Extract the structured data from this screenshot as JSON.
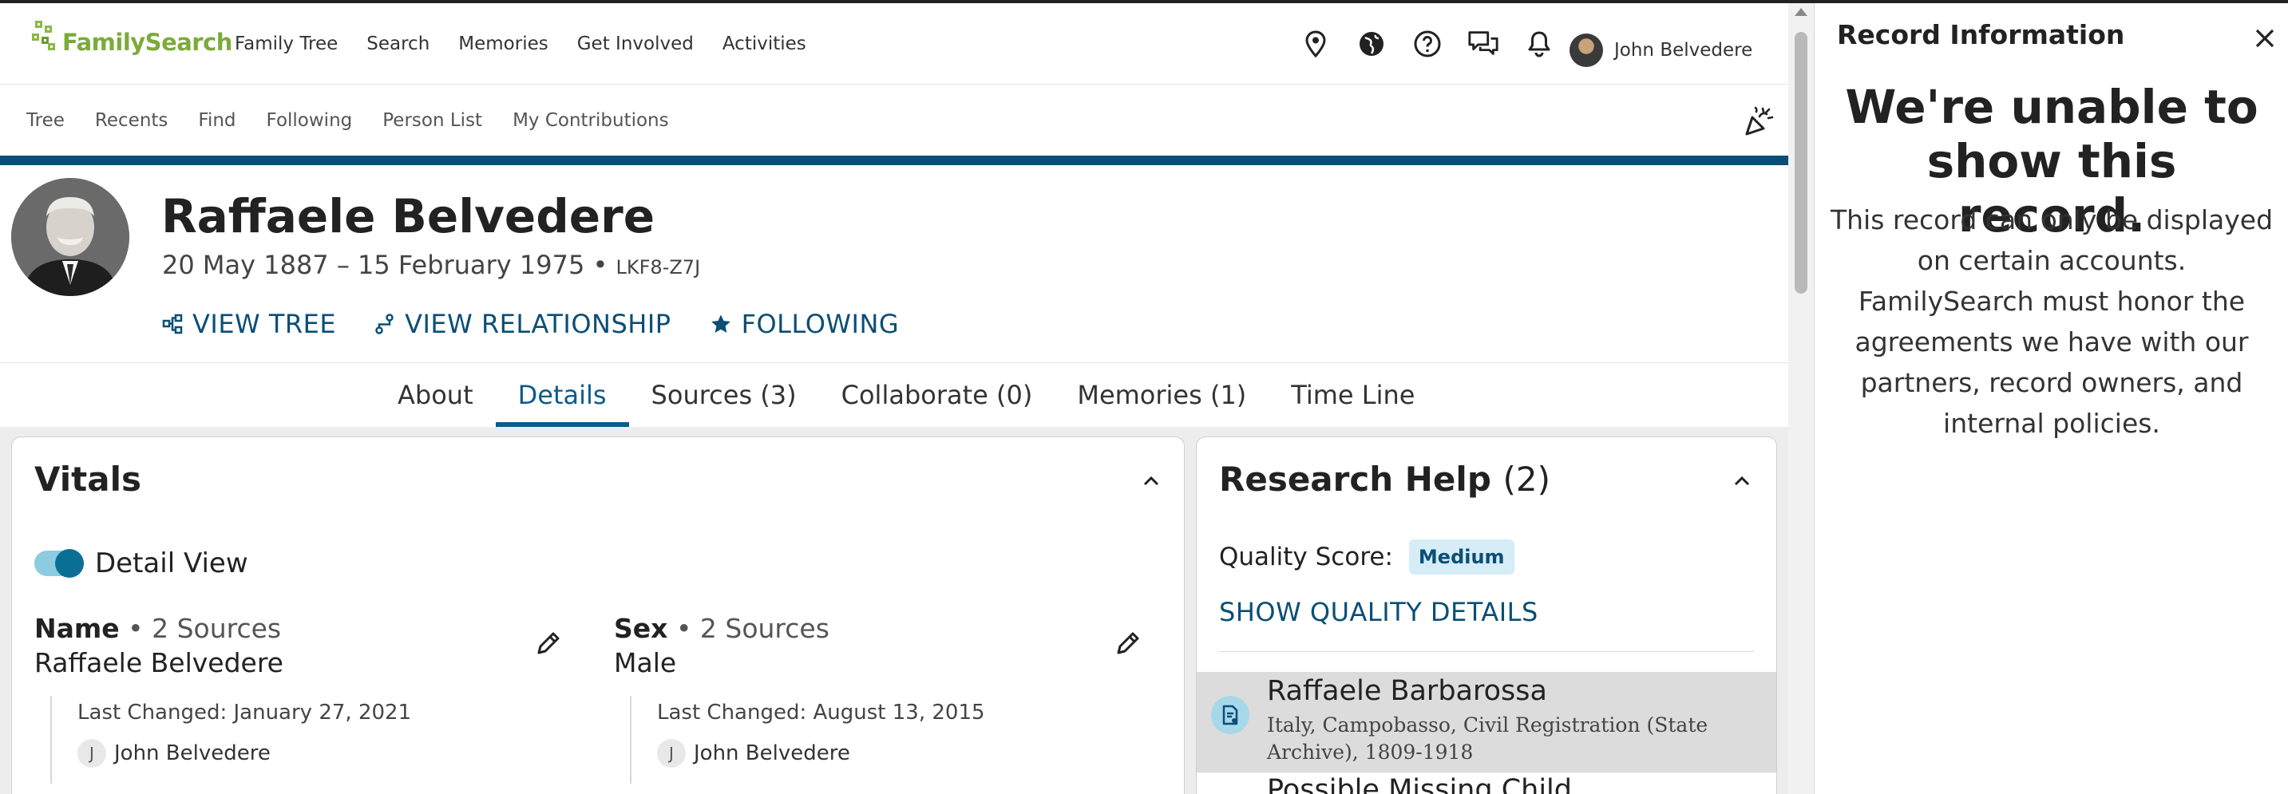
{
  "header": {
    "logo_text": "FamilySearch",
    "nav": [
      "Family Tree",
      "Search",
      "Memories",
      "Get Involved",
      "Activities"
    ],
    "icons": [
      "location-pin-icon",
      "globe-icon",
      "help-icon",
      "chat-icon",
      "bell-icon"
    ],
    "user_name": "John Belvedere"
  },
  "subnav": [
    "Tree",
    "Recents",
    "Find",
    "Following",
    "Person List",
    "My Contributions"
  ],
  "person": {
    "name": "Raffaele Belvedere",
    "dates": "20 May 1887 – 15 February 1975",
    "separator": " • ",
    "pid": "LKF8-Z7J",
    "actions": {
      "view_tree": "VIEW TREE",
      "view_relationship": "VIEW RELATIONSHIP",
      "following": "FOLLOWING"
    }
  },
  "tabs": [
    {
      "label": "About"
    },
    {
      "label": "Details"
    },
    {
      "label": "Sources (3)"
    },
    {
      "label": "Collaborate (0)"
    },
    {
      "label": "Memories (1)"
    },
    {
      "label": "Time Line"
    }
  ],
  "vitals": {
    "title": "Vitals",
    "toggle_label": "Detail View",
    "name_field": {
      "label": "Name",
      "sources": "• 2 Sources",
      "value": "Raffaele Belvedere",
      "last_changed": "Last Changed: January 27, 2021",
      "by_initial": "J",
      "by": "John Belvedere"
    },
    "sex_field": {
      "label": "Sex",
      "sources": "• 2 Sources",
      "value": "Male",
      "last_changed": "Last Changed: August 13, 2015",
      "by_initial": "J",
      "by": "John Belvedere"
    }
  },
  "research": {
    "title": "Research Help",
    "count": "(2)",
    "quality_label": "Quality Score:",
    "quality_value": "Medium",
    "show_details": "SHOW QUALITY DETAILS",
    "item_name": "Raffaele Barbarossa",
    "item_desc": "Italy, Campobasso, Civil Registration (State Archive), 1809-1918",
    "next_item": "Possible Missing Child"
  },
  "panel": {
    "title": "Record Information",
    "heading": "We're unable to show this record.",
    "body": "This record can only be displayed on certain accounts. FamilySearch must honor the agreements we have with our partners, record owners, and internal policies."
  },
  "colors": {
    "brand_blue": "#0b4e76",
    "brand_green": "#7bab3a",
    "badge_bg": "#d6ecf6"
  }
}
